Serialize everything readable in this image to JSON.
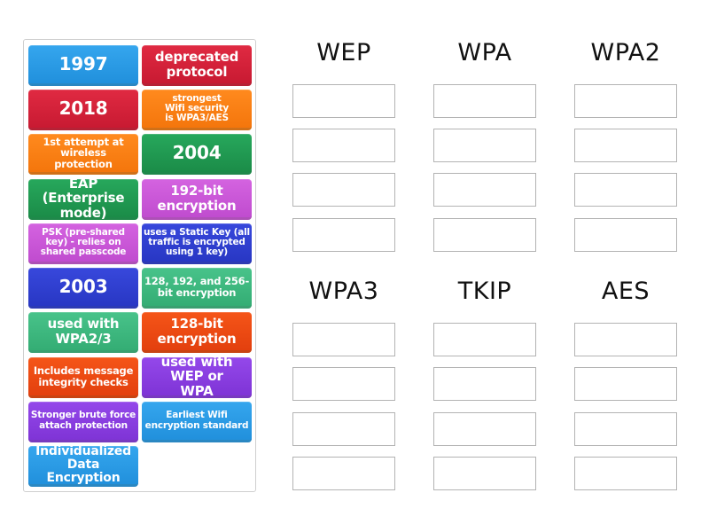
{
  "cards": [
    {
      "text": "1997",
      "color": "#2b9ae6"
    },
    {
      "text": "deprecated protocol",
      "color": "#d6223a"
    },
    {
      "text": "2018",
      "color": "#d6223a"
    },
    {
      "text": "strongest Wifi security is WPA3/AES",
      "color": "#f97d10"
    },
    {
      "text": "1st attempt at wireless protection",
      "color": "#f97d10"
    },
    {
      "text": "2004",
      "color": "#1f9d52"
    },
    {
      "text": "EAP (Enterprise mode)",
      "color": "#1f9d52"
    },
    {
      "text": "192-bit encryption",
      "color": "#c956d6"
    },
    {
      "text": "PSK (pre-shared key) - relies on shared passcode",
      "color": "#c956d6"
    },
    {
      "text": "uses a Static Key (all traffic is encrypted using 1 key)",
      "color": "#2f3fd1"
    },
    {
      "text": "2003",
      "color": "#2f3fd1"
    },
    {
      "text": "128, 192, and 256-bit encryption",
      "color": "#3cb97f"
    },
    {
      "text": "used with WPA2/3",
      "color": "#3cb97f"
    },
    {
      "text": "128-bit encryption",
      "color": "#f04a12"
    },
    {
      "text": "Includes message integrity checks",
      "color": "#f04a12"
    },
    {
      "text": "used with WEP or WPA",
      "color": "#8b3ee0"
    },
    {
      "text": "Stronger brute force attach protection",
      "color": "#8b3ee0"
    },
    {
      "text": "Earliest Wifi encryption standard",
      "color": "#2b9ae6"
    },
    {
      "text": "Individualized Data Encryption",
      "color": "#2b9ae6"
    }
  ],
  "categories": [
    {
      "title": "WEP",
      "slots": 4
    },
    {
      "title": "WPA",
      "slots": 4
    },
    {
      "title": "WPA2",
      "slots": 4
    },
    {
      "title": "WPA3",
      "slots": 4
    },
    {
      "title": "TKIP",
      "slots": 4
    },
    {
      "title": "AES",
      "slots": 4
    }
  ]
}
